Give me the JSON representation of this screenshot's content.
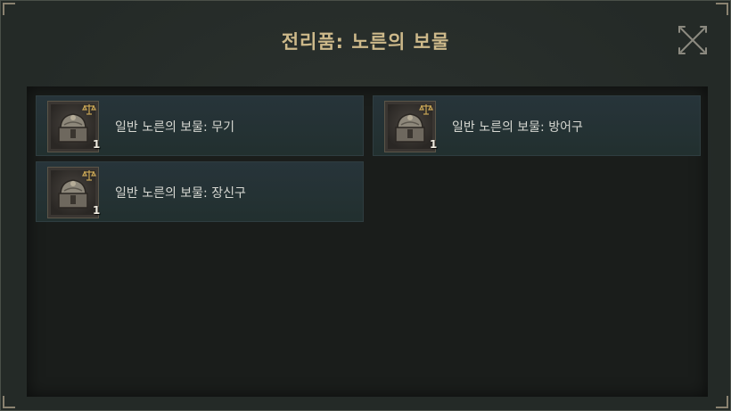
{
  "title": "전리품: 노른의 보물",
  "close_icon": "close-x-icon",
  "items": [
    {
      "label": "일반 노른의 보물: 무기",
      "qty": "1",
      "icon": "treasure-chest-icon",
      "badge_icon": "scale-icon"
    },
    {
      "label": "일반 노른의 보물: 방어구",
      "qty": "1",
      "icon": "treasure-chest-icon",
      "badge_icon": "scale-icon"
    },
    {
      "label": "일반 노른의 보물: 장신구",
      "qty": "1",
      "icon": "treasure-chest-icon",
      "badge_icon": "scale-icon"
    }
  ],
  "colors": {
    "title": "#cdb98a",
    "item_bg": "#26343a",
    "panel_bg": "#1a1d1b",
    "window_bg": "#242a27"
  }
}
